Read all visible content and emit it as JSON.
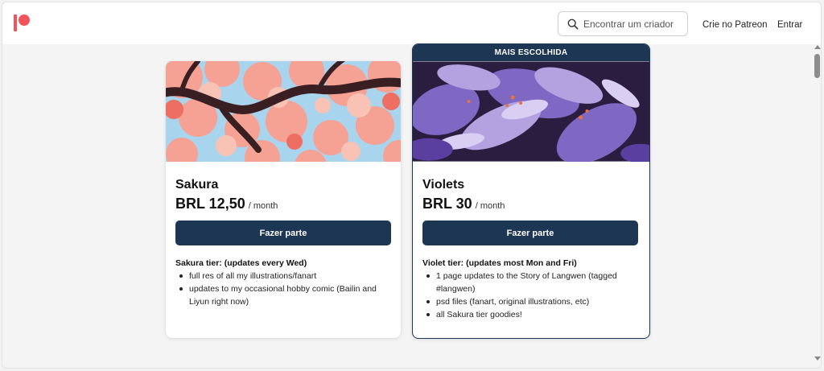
{
  "header": {
    "logo": "patreon-logo",
    "search": {
      "placeholder": "Encontrar um criador",
      "value": ""
    },
    "nav": {
      "create_label": "Crie no Patreon",
      "login_label": "Entrar"
    }
  },
  "tiers": [
    {
      "name": "Sakura",
      "price": "BRL 12,50",
      "period": "/ month",
      "join_label": "Fazer parte",
      "description_title": "Sakura tier: (updates every Wed)",
      "benefits": [
        "full res of all my illustrations/fanart",
        "updates to my occasional hobby comic (Bailin and Liyun right now)"
      ],
      "image": "cherry-blossom-illustration"
    },
    {
      "badge": "MAIS ESCOLHIDA",
      "name": "Violets",
      "price": "BRL 30",
      "period": "/ month",
      "join_label": "Fazer parte",
      "description_title": "Violet tier: (updates most Mon and Fri)",
      "benefits": [
        "1 page updates to the Story of Langwen (tagged #langwen)",
        "psd files (fanart, original illustrations, etc)",
        "all Sakura tier goodies!"
      ],
      "image": "violet-flowers-illustration"
    }
  ],
  "colors": {
    "brand": "#f2545b",
    "button": "#1c3653",
    "background": "#f4f4f5"
  }
}
